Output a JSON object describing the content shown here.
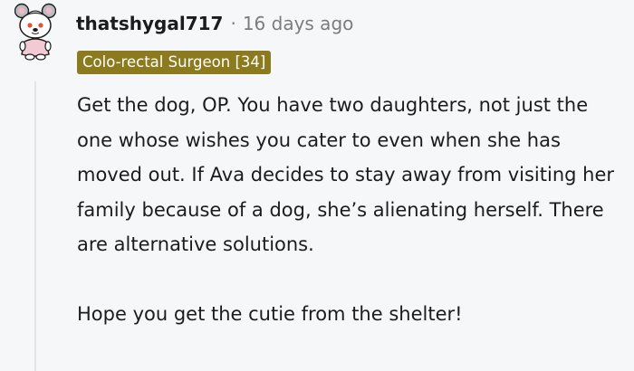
{
  "comment": {
    "username": "thatshygal717",
    "separator": "·",
    "timestamp": "16 days ago",
    "flair": "Colo-rectal Surgeon [34]",
    "paragraphs": [
      "Get the dog, OP. You have two daughters, not just the one whose wishes you cater to even when she has moved out. If Ava decides to stay away from visiting her family because of a dog, she’s alienating herself. There are alternative solutions.",
      "Hope you get the cutie from the shelter!"
    ]
  },
  "icons": {
    "avatar": "snoo-avatar-icon"
  },
  "colors": {
    "flair_background": "#8c7b1e",
    "flair_text": "#ffffff",
    "username": "#1c1c1c",
    "meta_text": "#7c7c7c",
    "body_text": "#1c1c1c",
    "thread_line": "#e2e4e6",
    "page_background": "#f6f7f8"
  }
}
